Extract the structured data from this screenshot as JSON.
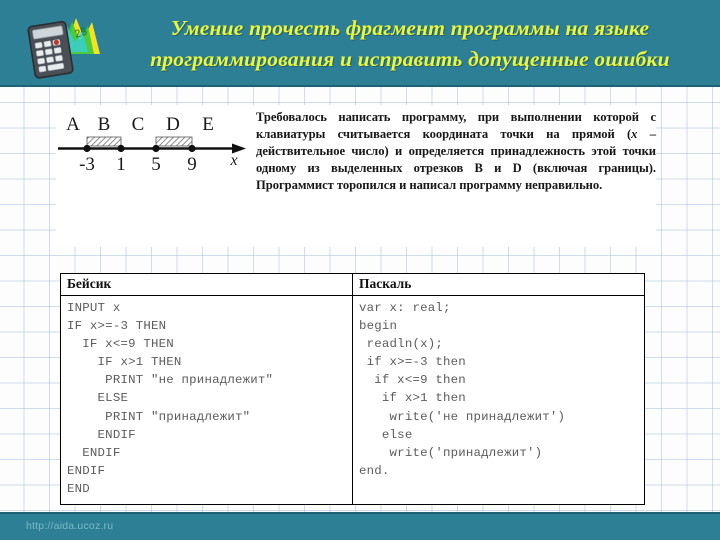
{
  "header": {
    "icon": "calculator-chart-icon",
    "title_lines": [
      "Умение прочесть фрагмент программы на языке",
      "программирования и исправить допущенные ошибки"
    ],
    "background_color": "#2d7f95",
    "title_color": "#ecf73a"
  },
  "numberline": {
    "point_labels": [
      "A",
      "B",
      "C",
      "D",
      "E"
    ],
    "tick_values": [
      "-3",
      "1",
      "5",
      "9"
    ],
    "axis_label": "x",
    "shaded_segments": [
      {
        "name": "B",
        "from": "-3",
        "to": "1"
      },
      {
        "name": "D",
        "from": "5",
        "to": "9"
      }
    ]
  },
  "problem": {
    "text_parts": [
      "Требовалось написать программу, при выполнении которой с клавиатуры считывается координата точки на прямой (",
      "x",
      " – действительное число) и определяется принадлежность этой точки одному из выделенных отрезков B и D (включая границы). Программист торопился и написал программу неправильно."
    ]
  },
  "code_table": {
    "basic": {
      "title": "Бейсик",
      "code": "INPUT x\nIF x>=-3 THEN\n  IF x<=9 THEN\n    IF x>1 THEN\n     PRINT \"не принадлежит\"\n    ELSE\n     PRINT \"принадлежит\"\n    ENDIF\n  ENDIF\nENDIF\nEND"
    },
    "pascal": {
      "title": "Паскаль",
      "code": "var x: real;\nbegin\n readln(x);\n if x>=-3 then\n  if x<=9 then\n   if x>1 then\n    write('не принадлежит')\n   else\n    write('принадлежит')\nend."
    }
  },
  "footer": {
    "url": "http://aida.ucoz.ru"
  }
}
